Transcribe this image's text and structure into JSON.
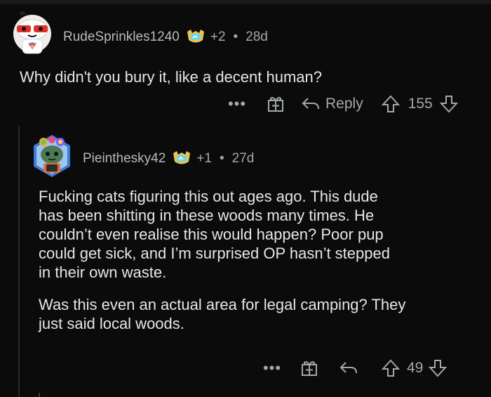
{
  "comment1": {
    "username": "RudeSprinkles1240",
    "score_delta": "+2",
    "separator": "•",
    "age": "28d",
    "body": "Why didn't you bury it, like a decent human?",
    "actions": {
      "more": "•••",
      "reply_label": "Reply",
      "votes": "155"
    }
  },
  "comment2": {
    "username": "Pieinthesky42",
    "score_delta": "+1",
    "separator": "•",
    "age": "27d",
    "paragraphs": [
      "Fucking  cats figuring this out ages ago. This dude\nhas been shitting in these woods many times. He\ncouldn’t even realise this would happen? Poor pup\ncould get sick, and I’m surprised OP hasn’t stepped\nin their own waste.",
      "Was this even an actual area for legal camping? They\njust said local woods."
    ],
    "actions": {
      "more": "•••",
      "votes": "49"
    }
  },
  "icons": {
    "award": "award-badge-icon",
    "gift": "award-gift-icon",
    "reply": "reply-arrow-icon",
    "upvote": "upvote-arrow-icon",
    "downvote": "downvote-arrow-icon"
  },
  "colors": {
    "background": "#0b0b0b",
    "text": "#e5e6e7",
    "muted": "#a3a7ab"
  }
}
